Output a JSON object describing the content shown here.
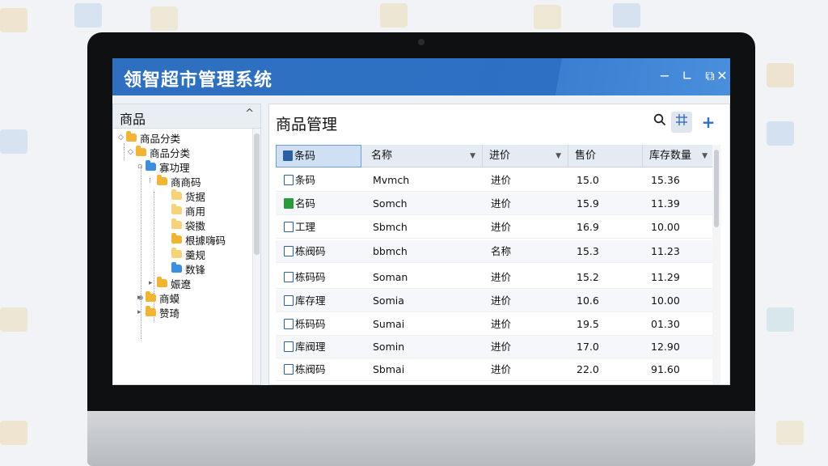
{
  "app": {
    "title": "领智超市管理系统"
  },
  "window_controls": {
    "minimize": "−",
    "restore": "∟",
    "popout": "⧉",
    "close": "✕"
  },
  "tree": {
    "header": "商品",
    "collapse_icon": "^",
    "nodes": [
      {
        "label": "商品分类",
        "folder": "orange"
      },
      {
        "label": "商品分类",
        "folder": "orange"
      },
      {
        "label": "寡功理",
        "folder": "blue"
      },
      {
        "label": "商商码",
        "folder": "orange"
      },
      {
        "label": "货据",
        "folder": "light"
      },
      {
        "label": "商用",
        "folder": "light"
      },
      {
        "label": "袋擞",
        "folder": "light"
      },
      {
        "label": "根據嗨码",
        "folder": "orange"
      },
      {
        "label": "羹规",
        "folder": "light"
      },
      {
        "label": "数锋",
        "folder": "blue"
      },
      {
        "label": "娠遼",
        "folder": "orange"
      },
      {
        "label": "商蟆",
        "folder": "orange"
      },
      {
        "label": "赞琦",
        "folder": "orange"
      }
    ]
  },
  "main": {
    "title": "商品管理",
    "tools": {
      "search_icon": "search-icon",
      "grid_icon": "grid-icon",
      "add_label": "+"
    },
    "columns": [
      "条码",
      "名称",
      "进价",
      "售价",
      "库存数量"
    ],
    "rows": [
      [
        "条码",
        "Mvmch",
        "进价",
        "15.0",
        "15.36"
      ],
      [
        "名码",
        "Somch",
        "进价",
        "15.9",
        "11.39"
      ],
      [
        "工理",
        "Sbmch",
        "进价",
        "16.9",
        "10.00"
      ],
      [
        "栋阀码",
        "bbmch",
        "名称",
        "15.3",
        "11.23"
      ],
      [
        "栋码码",
        "Soman",
        "进价",
        "15.2",
        "11.29"
      ],
      [
        "库存理",
        "Somia",
        "进价",
        "10.6",
        "10.00"
      ],
      [
        "栎码码",
        "Sumai",
        "进价",
        "19.5",
        "01.30"
      ],
      [
        "库阀理",
        "Somin",
        "进价",
        "17.0",
        "12.90"
      ],
      [
        "栋阀码",
        "Sbmai",
        "进价",
        "22.0",
        "91.60"
      ]
    ]
  },
  "colors": {
    "titlebar": "#2f6fbf",
    "header_bg": "#e4ebf3",
    "accent": "#2b6fc4"
  }
}
